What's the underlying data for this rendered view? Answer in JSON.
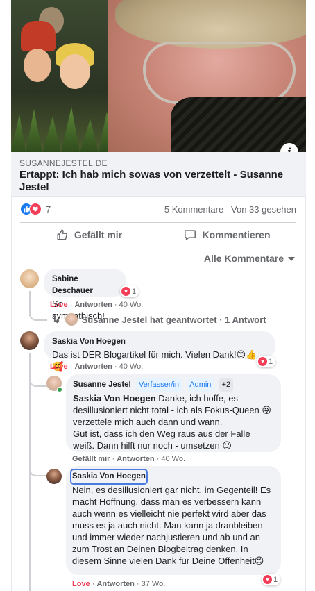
{
  "link": {
    "domain": "SUSANNEJESTEL.DE",
    "title": "Ertappt: Ich hab mich sowas von verzettelt - Susanne Jestel",
    "info_icon": "i"
  },
  "stats": {
    "reaction_count": "7",
    "comments": "5 Kommentare",
    "views": "Von 33 gesehen"
  },
  "actions": {
    "like": "Gefällt mir",
    "comment": "Kommentieren"
  },
  "sort": {
    "label": "Alle Kommentare"
  },
  "comments": [
    {
      "author": "Sabine Deschauer",
      "text": "So sympathisch!",
      "reactions": "1",
      "love": "Love",
      "reply": "Antworten",
      "time": "· 40 Wo.",
      "replied_summary": "Susanne Jestel hat geantwortet · 1 Antwort"
    },
    {
      "author": "Saskia Von Hoegen",
      "text": "Das ist DER Blogartikel für mich. Vielen Dank!😊👍🥰",
      "reactions": "1",
      "love": "Love",
      "reply": "Antworten",
      "time": "· 40 Wo."
    }
  ],
  "replies": [
    {
      "author": "Susanne Jestel",
      "badge_author": "Verfasser/in",
      "badge_admin": "Admin",
      "badge_more": "+2",
      "mention": "Saskia Von Hoegen",
      "text1": " Danke, ich hoffe, es desillusioniert nicht total - ich als Fokus-Queen 😜verzettele mich auch dann und wann.",
      "text2": "Gut ist, dass ich den Weg raus aus der Falle weiß. Dann hilft nur noch - umsetzen 😉",
      "like": "Gefällt mir",
      "reply": "Antworten",
      "time": "· 40 Wo."
    },
    {
      "author": "Saskia Von Hoegen",
      "text": "Nein, es desillusioniert gar nicht, im Gegenteil! Es macht Hoffnung, dass man es verbessern kann auch wenn es vielleicht nie perfekt wird aber das muss es ja auch nicht. Man kann ja dranbleiben und immer wieder nachjustieren und ab und an zum Trost an Deinen Blogbeitrag denken. In diesem Sinne vielen Dank für Deine Offenheit😉",
      "reactions": "1",
      "love": "Love",
      "reply": "Antworten",
      "time": "· 37 Wo."
    }
  ],
  "colors": {
    "accent": "#1877f2",
    "love": "#f33e58",
    "muted": "#65676b",
    "bubble": "#f0f2f5"
  }
}
